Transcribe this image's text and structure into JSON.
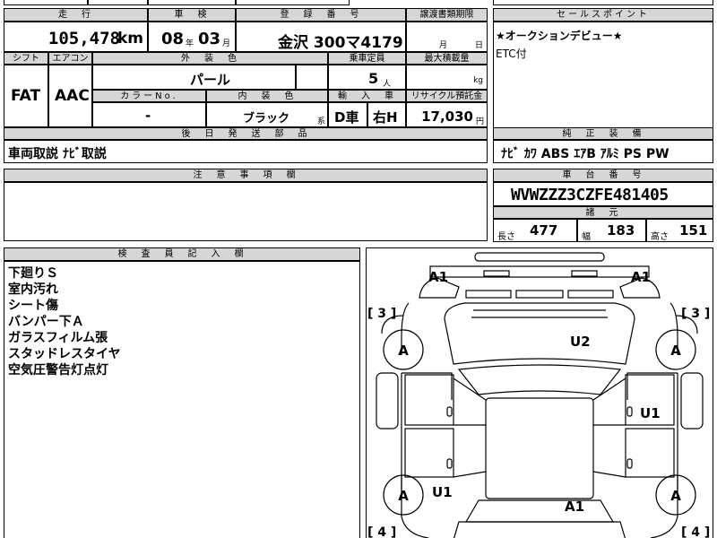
{
  "top": {
    "h_mileage": "走　行",
    "h_inspection": "車　検",
    "h_regno": "登　録　番　号",
    "h_transfer": "譲渡書類期限",
    "mileage": "105,478",
    "mileage_unit": "km",
    "insp_year": "08",
    "insp_year_unit": "年",
    "insp_month": "03",
    "insp_month_unit": "月",
    "reg": "金沢 300マ4179",
    "transfer_month": "月",
    "transfer_day": "日"
  },
  "sales": {
    "header": "セールスポイント",
    "line1": "★オークションデビュー★",
    "line2": "ETC付"
  },
  "row2": {
    "h_shift": "シフト",
    "h_ac": "エアコン",
    "h_exterior": "外　装　色",
    "h_capacity": "乗車定員",
    "h_maxload": "最大積載量",
    "shift": "FAT",
    "ac": "AAC",
    "exterior": "パール",
    "capacity": "5",
    "capacity_unit": "人",
    "maxload_unit": "kg",
    "h_colorno": "カラーNo.",
    "h_interior": "内　装　色",
    "h_import": "輸　入　車",
    "h_recycle": "リサイクル預託金",
    "colorno": "-",
    "interior": "ブラック",
    "interior_unit": "系",
    "import1": "D車",
    "import2": "右H",
    "recycle": "17,030",
    "recycle_unit": "円"
  },
  "later": {
    "header": "後　日　発　送　部　品",
    "value": "車両取説 ﾅﾋﾞ取説"
  },
  "equipment": {
    "header": "純　正　装　備",
    "value": "ﾅﾋﾞ ｶﾜ ABS ｴｱB ｱﾙﾐ PS PW"
  },
  "notes": {
    "header": "注　意　事　項　欄"
  },
  "chassis": {
    "header": "車　台　番　号",
    "value": "WVWZZZ3CZFE481405",
    "dims_header": "諸　元",
    "len_label": "長さ",
    "len": "477",
    "wid_label": "幅",
    "wid": "183",
    "hei_label": "高さ",
    "hei": "151"
  },
  "inspector": {
    "header": "検　査　員　記　入　欄",
    "lines": [
      "下廻りＳ",
      "室内汚れ",
      "シート傷",
      "バンパー下Ａ",
      "ガラスフィルム張",
      "スタッドレスタイヤ",
      "空気圧警告灯点灯"
    ]
  },
  "diagram": {
    "tire_fl": "[ 3 ]",
    "tire_fr": "[ 3 ]",
    "tire_rl": "[ 4 ]",
    "tire_rr": "[ 4 ]",
    "a1_front_left": "A1",
    "a1_front_right": "A1",
    "u2_hood": "U2",
    "u1_right_side": "U1",
    "u1_left_rear": "U1",
    "a1_rear": "A1",
    "wheel_mark": "A"
  }
}
